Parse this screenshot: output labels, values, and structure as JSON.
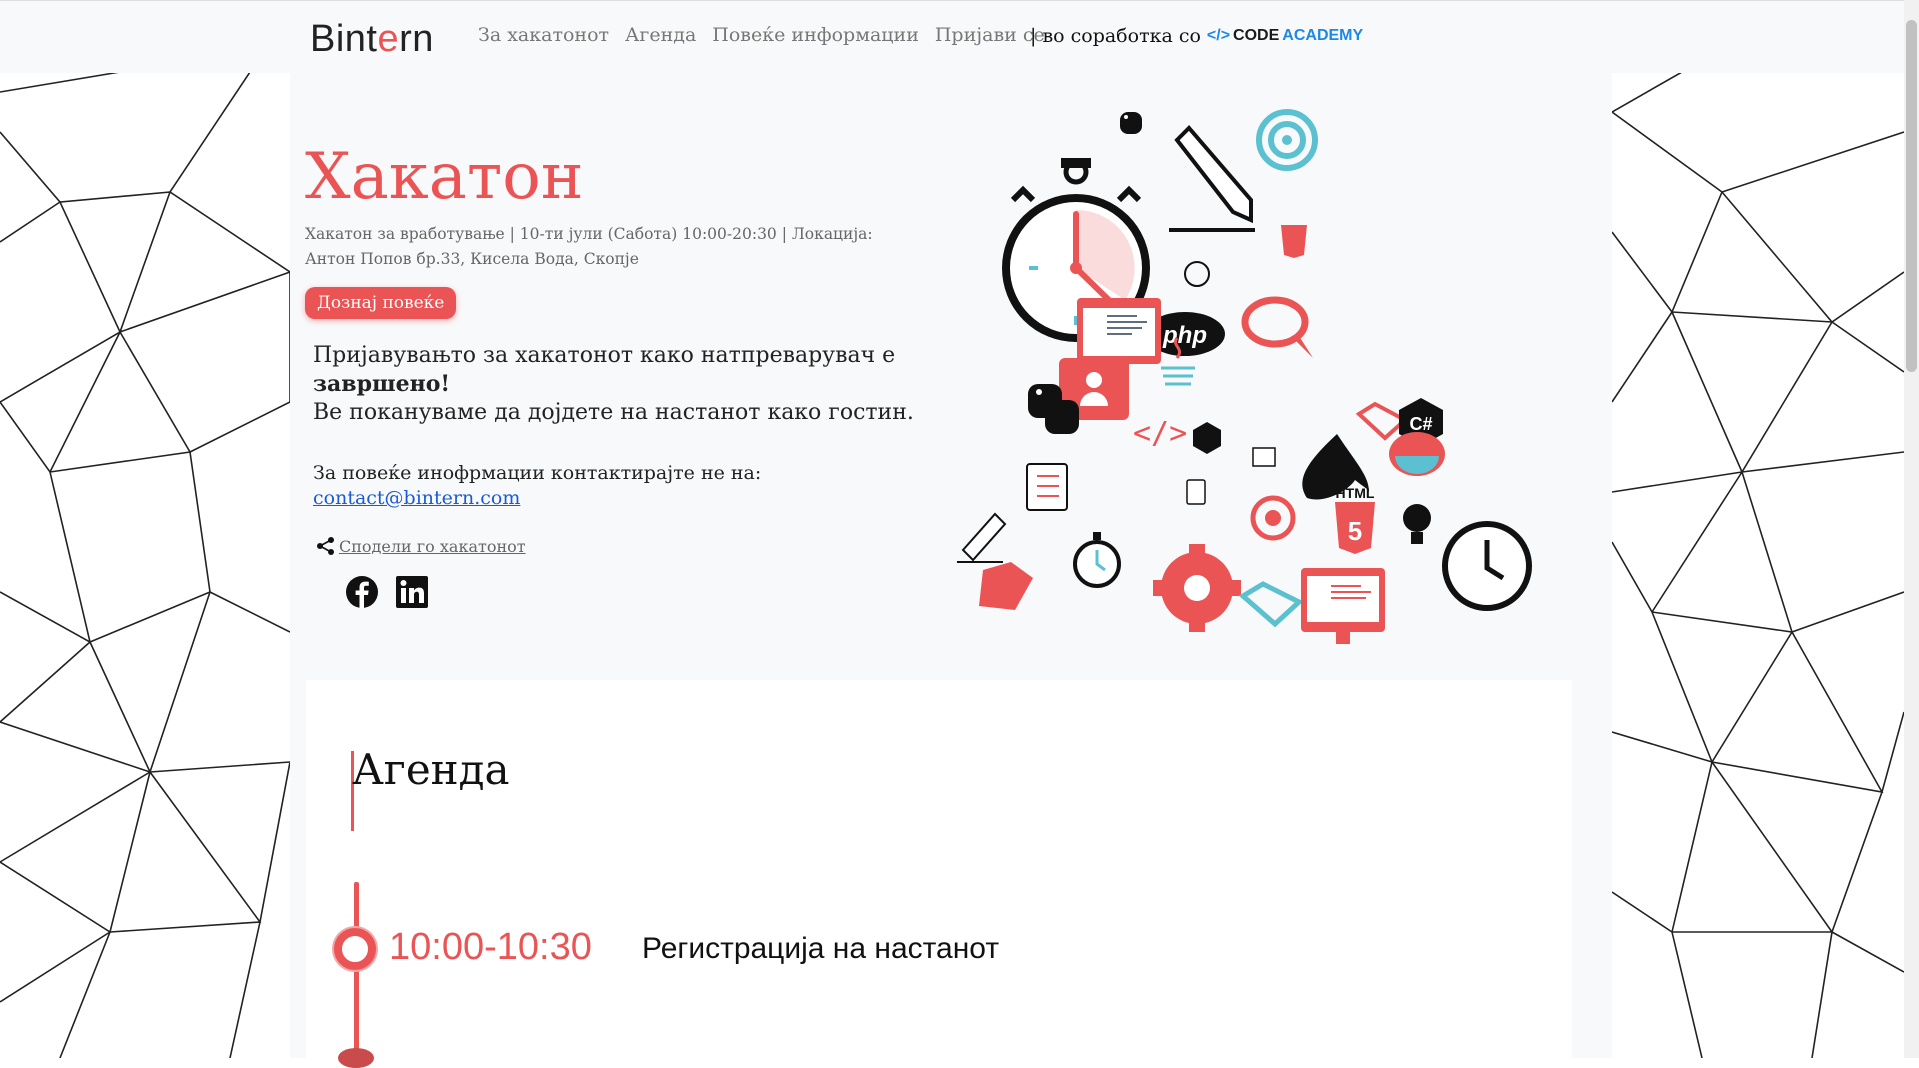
{
  "header": {
    "logo": {
      "pre": "Bint",
      "accent": "e",
      "post": "rn"
    },
    "nav": [
      "За хакатонот",
      "Агенда",
      "Повеќе информации",
      "Пријави се"
    ],
    "collab": "| во соработка со",
    "partner": {
      "bracket": "</>",
      "code": "CODE",
      "academy": "ACADEMY"
    }
  },
  "hero": {
    "title": "Хакатон",
    "subtitle": "Хакатон за вработување | 10-ти јули (Сабота) 10:00-20:30 | Локација:  Антон Попов бр.33, Кисела Вода, Скопје",
    "cta": "Дознај повеќе",
    "notice_line1": "Пријавувањто за хакатонот како натпреварувач е",
    "notice_bold": "завршено!",
    "notice_line2": "Ве покануваме да дојдете на настанот како гостин.",
    "contact_label": "За повеќе инофрмации контактирајте не на:",
    "contact_email": "contact@bintern.com",
    "share_label": "Сподели го хакатонот",
    "socials": [
      "facebook-icon",
      "linkedin-icon"
    ]
  },
  "illustration": {
    "labels": {
      "php": "php",
      "html": "HTML",
      "html5": "5",
      "csharp": "C#"
    },
    "colors": {
      "accent": "#ea5455",
      "teal": "#5bc0cf",
      "dark": "#111111"
    }
  },
  "agenda": {
    "title": "Агенда",
    "items": [
      {
        "time": "10:00-10:30",
        "text": "Регистрација на настанот"
      }
    ]
  },
  "colors": {
    "accent": "#ea5455",
    "link": "#1a5ad6",
    "nav": "#777777"
  }
}
